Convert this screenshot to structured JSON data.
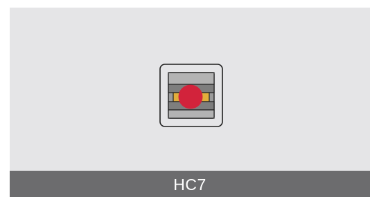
{
  "thumbnail": {
    "icon": "bearing-warning-icon",
    "label": "HC7"
  },
  "colors": {
    "panel_background": "#e5e5e7",
    "footer_background": "#6c6c6e",
    "label_text": "#ffffff",
    "indicator": "#d2233b",
    "accent": "#e2ae3c"
  }
}
